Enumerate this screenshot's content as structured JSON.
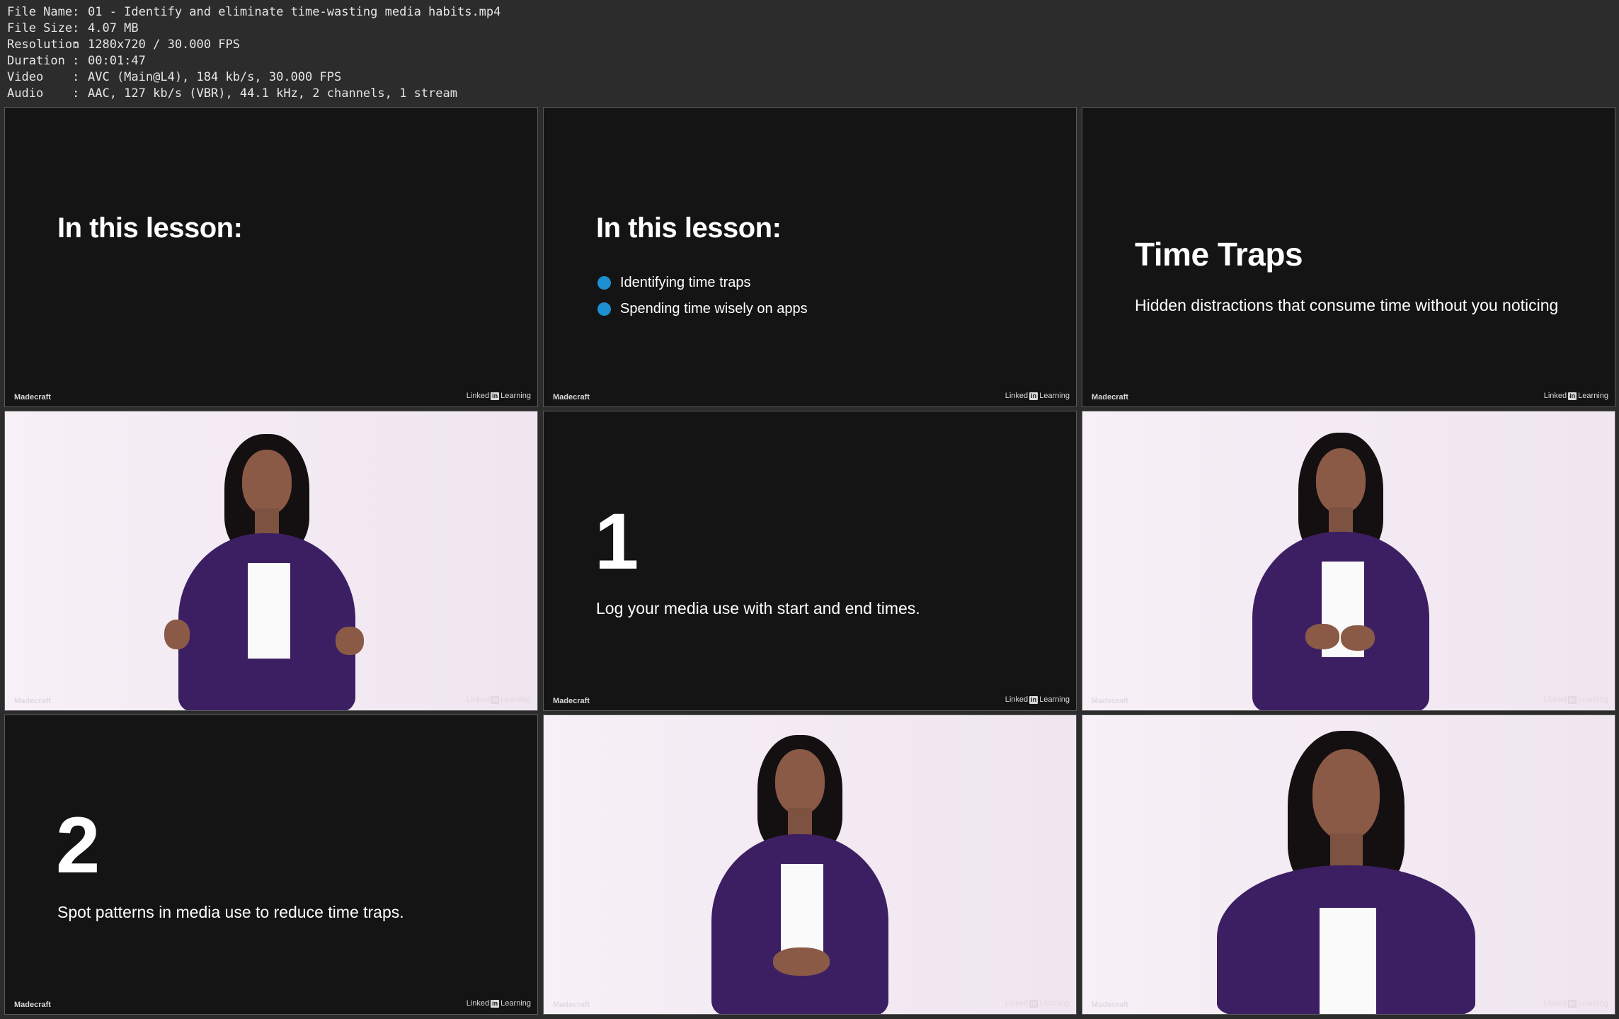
{
  "file_info": [
    {
      "key": "File Name",
      "value": "01 - Identify and eliminate time-wasting media habits.mp4"
    },
    {
      "key": "File Size",
      "value": "4.07 MB"
    },
    {
      "key": "Resolution",
      "value": "1280x720 / 30.000 FPS"
    },
    {
      "key": "Duration",
      "value": "00:01:47"
    },
    {
      "key": "Video",
      "value": "AVC (Main@L4), 184 kb/s, 30.000 FPS"
    },
    {
      "key": "Audio",
      "value": "AAC, 127 kb/s (VBR), 44.1 kHz, 2 channels, 1 stream"
    }
  ],
  "separator": ":",
  "brand": {
    "left": "Madecraft",
    "linked": "Linked",
    "in": "in",
    "learning": "Learning"
  },
  "frames": {
    "f1": {
      "title": "In this lesson:"
    },
    "f2": {
      "title": "In this lesson:",
      "bullets": [
        "Identifying time traps",
        "Spending time wisely on apps"
      ]
    },
    "f3": {
      "title": "Time Traps",
      "desc": "Hidden distractions that consume time without you noticing"
    },
    "f5": {
      "num": "1",
      "text": "Log your media use with start and end times."
    },
    "f7": {
      "num": "2",
      "text": "Spot patterns in media use to reduce time traps."
    }
  },
  "colors": {
    "bullet": "#1e8fd0",
    "blazer": "#3c1f63",
    "slide_bg": "#141414"
  }
}
